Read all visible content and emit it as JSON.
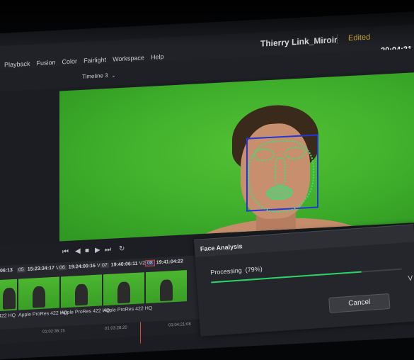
{
  "menu": {
    "items": [
      "Playback",
      "Fusion",
      "Color",
      "Fairlight",
      "Workspace",
      "Help"
    ]
  },
  "project": {
    "title": "Thierry Link_Miroir",
    "status": "Edited",
    "clock": "20:04:21"
  },
  "viewer": {
    "timeline_label": "Timeline 3"
  },
  "clips": [
    {
      "num": "",
      "tc": "06:13",
      "codec": "422 HQ",
      "selected": false
    },
    {
      "num": "05",
      "tc": "15:23:34:17",
      "track": "V2",
      "codec": "Apple ProRes 422 HQ",
      "selected": false
    },
    {
      "num": "06",
      "tc": "19:24:00:15",
      "track": "V2",
      "codec": "Apple ProRes 422 HQ",
      "selected": false
    },
    {
      "num": "07",
      "tc": "19:40:06:11",
      "track": "V2",
      "codec": "Apple ProRes 422 HQ",
      "selected": false
    },
    {
      "num": "08",
      "tc": "19:41:04:22",
      "track": "",
      "codec": "Apple ProRes 422 HQ",
      "selected": true
    }
  ],
  "ruler": [
    "01:02:36:15",
    "01:03:28:20",
    "01:04:21:08"
  ],
  "dialog": {
    "title": "Face Analysis",
    "processing_label": "Processing",
    "percent_text": "(79%)",
    "progress": 0.79,
    "cancel_label": "Cancel",
    "side_label": "V"
  },
  "colors": {
    "accent_edited": "#e5c43c",
    "progress": "#2bd46a",
    "face_box": "#2436d6",
    "landmarks": "#38e07a"
  }
}
